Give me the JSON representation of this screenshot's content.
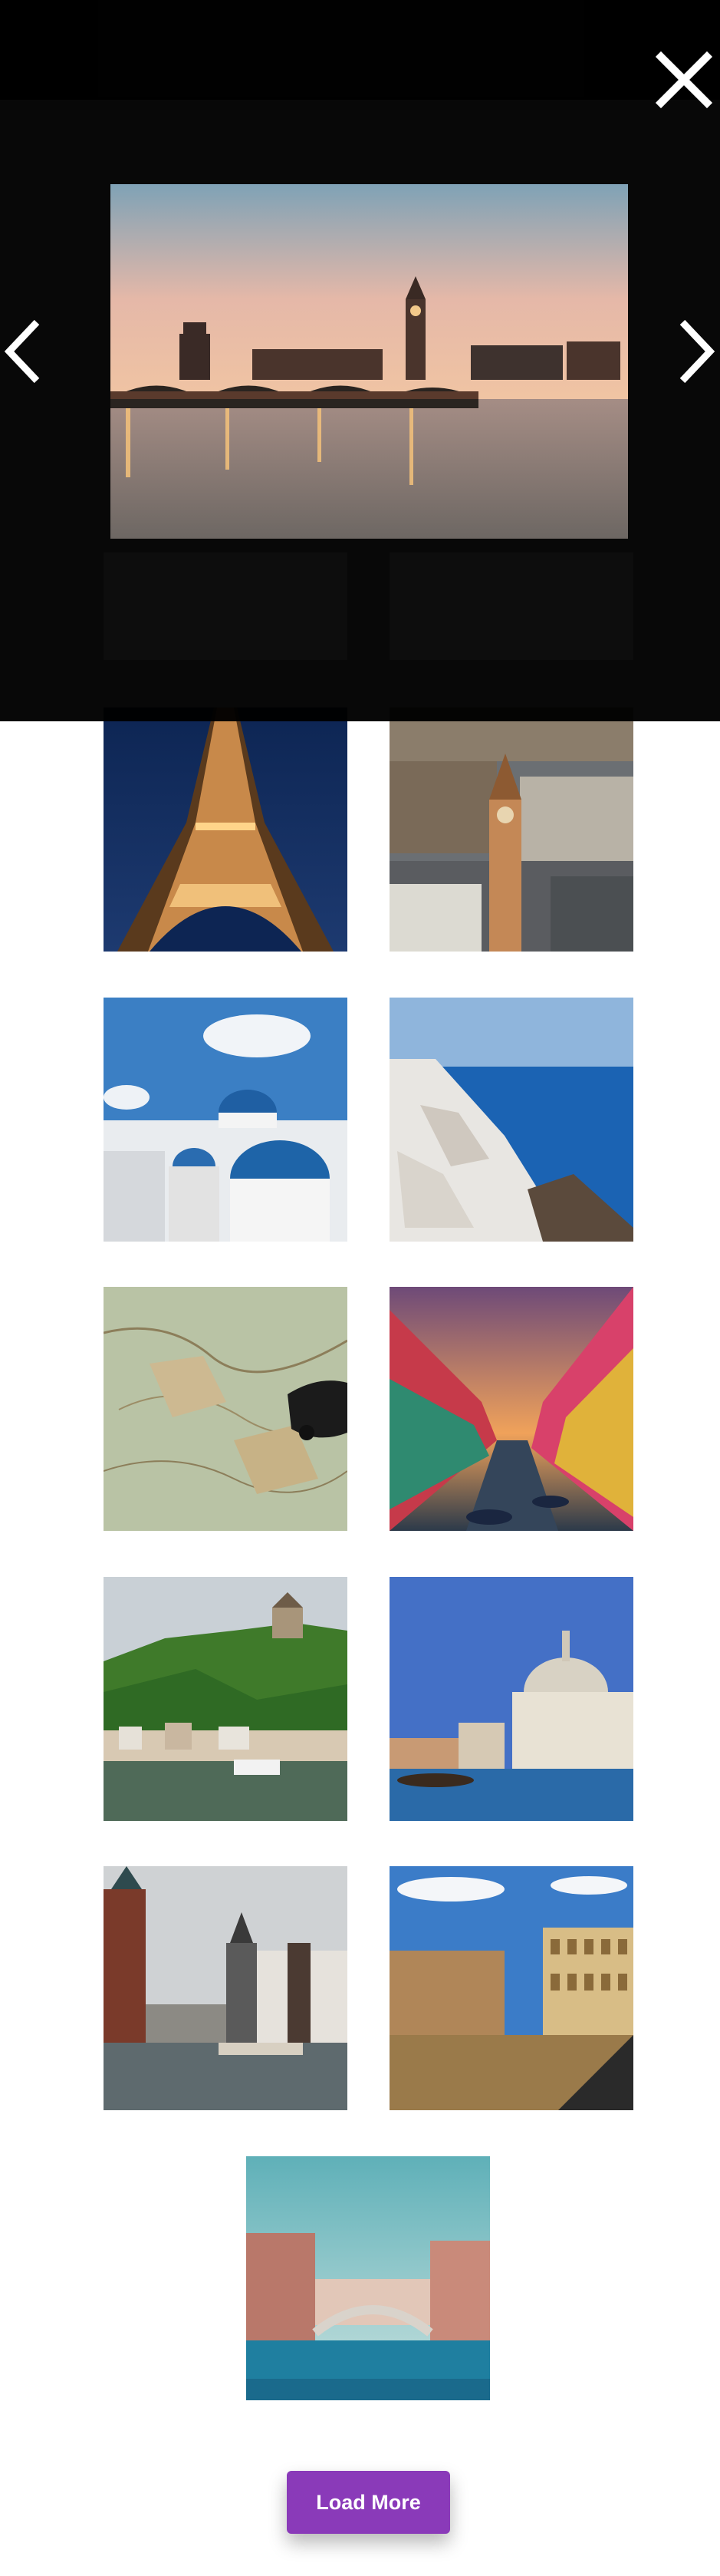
{
  "header": {
    "brand": "",
    "menu": ""
  },
  "lightbox": {
    "close_icon": "close-icon",
    "prev_icon": "chevron-left-icon",
    "next_icon": "chevron-right-icon",
    "image": "london-westminster-sunset"
  },
  "gallery": {
    "items": [
      "eiffel-tower-night",
      "london-big-ben-aerial",
      "santorini-blue-domes",
      "santorini-cliffs-sea",
      "vintage-map-toy-car",
      "burano-canal-sunset",
      "cochem-castle-riverside",
      "venice-santa-maria-della-salute",
      "amsterdam-canal",
      "rome-colosseum",
      "venice-rialto-bridge"
    ]
  },
  "actions": {
    "load_more": "Load More"
  },
  "colors": {
    "overlay": "#000000",
    "button": "#8a3ab9",
    "button_text": "#ffffff"
  }
}
